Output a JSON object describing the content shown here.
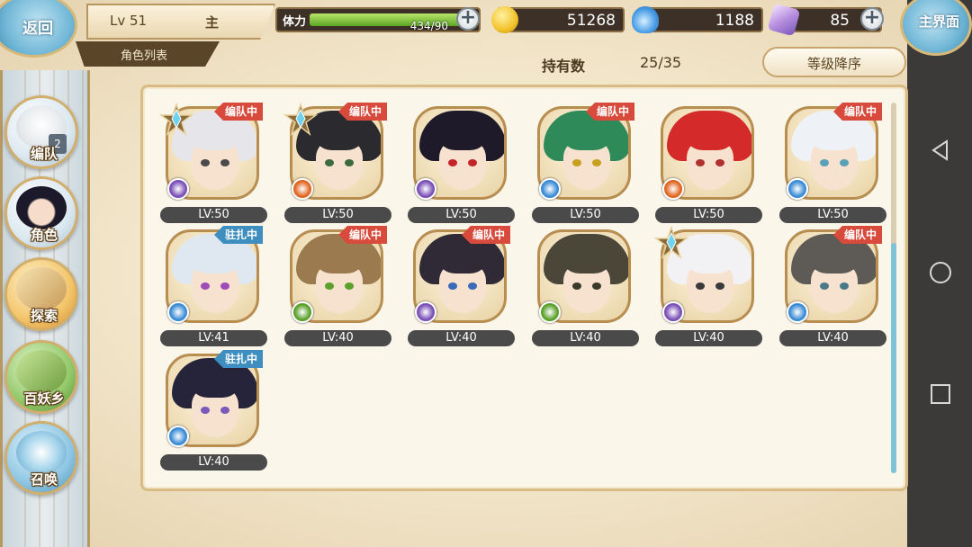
{
  "header": {
    "back_label": "返回",
    "level": "Lv 51",
    "player_name": "主",
    "section_title": "角色列表",
    "stamina_label": "体力",
    "stamina_value": "434/90",
    "stamina_fraction": 1.0,
    "gold": "51268",
    "soul_fire": "1188",
    "gems": "85",
    "home_label": "主界面"
  },
  "toolbar": {
    "owned_label": "持有数",
    "owned_value": "25/35",
    "sort_label": "等级降序"
  },
  "sidebar": {
    "items": [
      {
        "label": "编队"
      },
      {
        "label": "角色"
      },
      {
        "label": "探索"
      },
      {
        "label": "百妖乡"
      },
      {
        "label": "召唤"
      }
    ],
    "badge": "2"
  },
  "characters": [
    {
      "level": "LV:50",
      "tag": "编队中",
      "tag_type": "team",
      "star": true,
      "element": "#7a4fb6",
      "hair": "#e6e6ea",
      "eye": "#4a4a4a"
    },
    {
      "level": "LV:50",
      "tag": "编队中",
      "tag_type": "team",
      "star": true,
      "element": "#e0651f",
      "hair": "#2b2a2e",
      "eye": "#3c6a3c"
    },
    {
      "level": "LV:50",
      "tag": "",
      "tag_type": "",
      "star": false,
      "element": "#7a4fb6",
      "hair": "#1e1a2a",
      "eye": "#c2242a"
    },
    {
      "level": "LV:50",
      "tag": "编队中",
      "tag_type": "team",
      "star": false,
      "element": "#3a8bd6",
      "hair": "#2f8a5a",
      "eye": "#c8a020"
    },
    {
      "level": "LV:50",
      "tag": "",
      "tag_type": "",
      "star": false,
      "element": "#e0651f",
      "hair": "#d42a2a",
      "eye": "#b03030"
    },
    {
      "level": "LV:50",
      "tag": "编队中",
      "tag_type": "team",
      "star": false,
      "element": "#3a8bd6",
      "hair": "#eef2f6",
      "eye": "#5aa0b8"
    },
    {
      "level": "LV:41",
      "tag": "驻扎中",
      "tag_type": "station",
      "star": false,
      "element": "#3a8bd6",
      "hair": "#dfe8f0",
      "eye": "#a04ab8"
    },
    {
      "level": "LV:40",
      "tag": "编队中",
      "tag_type": "team",
      "star": false,
      "element": "#5aa02a",
      "hair": "#9a7a4e",
      "eye": "#5aa02a"
    },
    {
      "level": "LV:40",
      "tag": "编队中",
      "tag_type": "team",
      "star": false,
      "element": "#7a4fb6",
      "hair": "#2f2a36",
      "eye": "#3a6ab8"
    },
    {
      "level": "LV:40",
      "tag": "",
      "tag_type": "",
      "star": false,
      "element": "#5aa02a",
      "hair": "#4a4638",
      "eye": "#3a3a2a"
    },
    {
      "level": "LV:40",
      "tag": "",
      "tag_type": "",
      "star": true,
      "element": "#7a4fb6",
      "hair": "#f2f2f4",
      "eye": "#3a3a3a"
    },
    {
      "level": "LV:40",
      "tag": "编队中",
      "tag_type": "team",
      "star": false,
      "element": "#3a8bd6",
      "hair": "#5e5a56",
      "eye": "#4a7a8a"
    },
    {
      "level": "LV:40",
      "tag": "驻扎中",
      "tag_type": "station",
      "star": false,
      "element": "#3a8bd6",
      "hair": "#26243a",
      "eye": "#7a5ab8"
    }
  ],
  "colors": {
    "team_tag": "#d84b3c",
    "station_tag": "#3e8fbf",
    "stamina_fill": "#5ca624"
  }
}
